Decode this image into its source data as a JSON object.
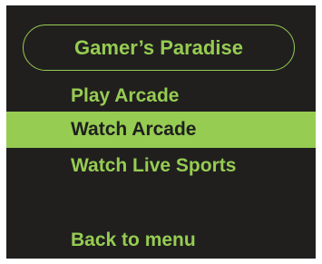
{
  "title": "Gamer’s Paradise",
  "menu": {
    "items": [
      {
        "label": "Play Arcade",
        "selected": false
      },
      {
        "label": "Watch Arcade",
        "selected": true
      },
      {
        "label": "Watch Live Sports",
        "selected": false
      },
      {
        "label": "Back to menu",
        "selected": false
      }
    ]
  },
  "colors": {
    "panel_background": "#201f1e",
    "accent": "#96cc52",
    "selected_text": "#1f1f1f",
    "page_background": "#ffffff"
  }
}
